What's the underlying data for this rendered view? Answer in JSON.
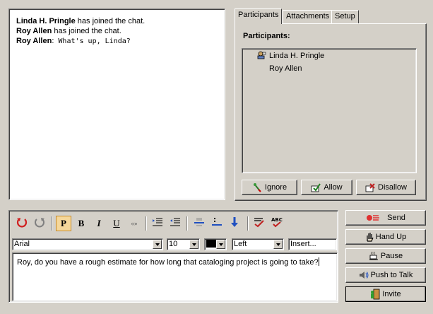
{
  "chat_log": {
    "lines": [
      {
        "name": "Linda H. Pringle",
        "text": "has joined the chat."
      },
      {
        "name": "Roy Allen",
        "text": "has joined the chat."
      },
      {
        "name": "Roy Allen",
        "sep": ":",
        "text": " What's up, Linda?"
      }
    ]
  },
  "tabs": [
    {
      "label": "Participants",
      "active": true
    },
    {
      "label": "Attachments",
      "active": false
    },
    {
      "label": "Setup",
      "active": false
    }
  ],
  "participants": {
    "heading": "Participants:",
    "list": [
      "Linda H. Pringle",
      "Roy Allen"
    ],
    "buttons": {
      "ignore": "Ignore",
      "allow": "Allow",
      "disallow": "Disallow"
    }
  },
  "toolbar": {
    "icons": [
      "undo-icon",
      "redo-icon",
      "paragraph-icon",
      "bold-icon",
      "italic-icon",
      "underline-icon",
      "quote-icon",
      "indent-icon",
      "outdent-icon",
      "horizontal-rule-icon",
      "list-icon",
      "insert-down-icon",
      "spellcheck-icon",
      "abc-check-icon"
    ],
    "p_label": "P",
    "bold_label": "B",
    "italic_label": "I",
    "underline_label": "U",
    "quote_label": "«»"
  },
  "format": {
    "font": "Arial",
    "size": "10",
    "color": "#000000",
    "align": "Left",
    "insert": "Insert..."
  },
  "compose": {
    "text": "Roy, do you have a rough estimate for how long that cataloging project is going to take?"
  },
  "actions": {
    "send": "Send",
    "hand_up": "Hand Up",
    "pause": "Pause",
    "push_to_talk": "Push to Talk",
    "invite": "Invite"
  }
}
